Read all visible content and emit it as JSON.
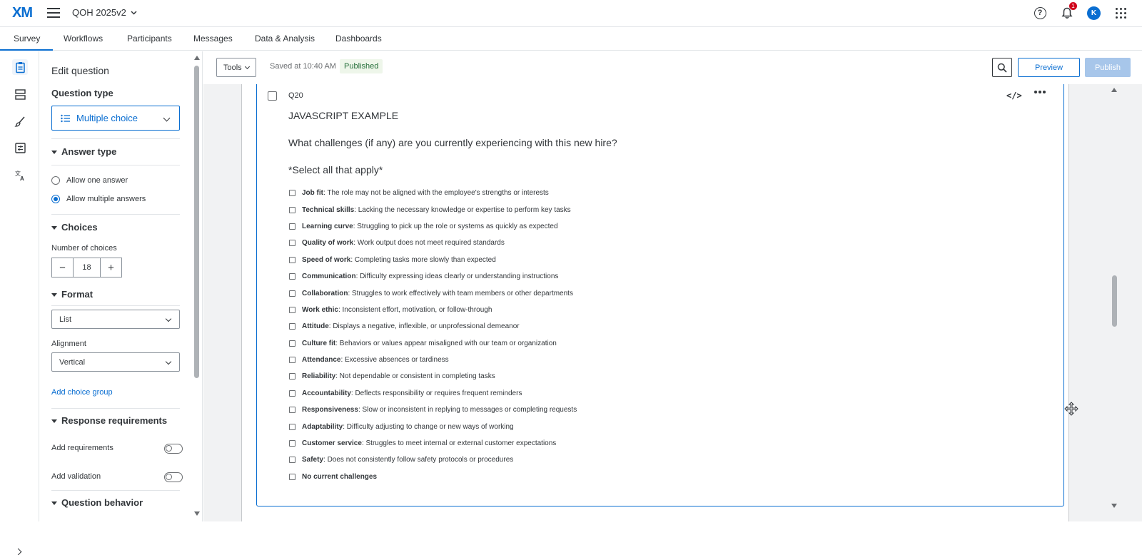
{
  "header": {
    "logo": "XM",
    "project_name": "QOH 2025v2",
    "notification_count": "1",
    "avatar_initial": "K"
  },
  "nav": {
    "tabs": [
      {
        "label": "Survey",
        "active": true
      },
      {
        "label": "Workflows"
      },
      {
        "label": "Participants"
      },
      {
        "label": "Messages"
      },
      {
        "label": "Data & Analysis"
      },
      {
        "label": "Dashboards"
      }
    ]
  },
  "panel": {
    "title": "Edit question",
    "question_type_heading": "Question type",
    "question_type_value": "Multiple choice",
    "answer_type_heading": "Answer type",
    "answer_options": [
      "Allow one answer",
      "Allow multiple answers"
    ],
    "answer_selected": 1,
    "choices_heading": "Choices",
    "number_of_choices_label": "Number of choices",
    "number_of_choices_value": "18",
    "format_heading": "Format",
    "format_value": "List",
    "alignment_label": "Alignment",
    "alignment_value": "Vertical",
    "add_choice_group": "Add choice group",
    "response_requirements_heading": "Response requirements",
    "add_requirements": "Add requirements",
    "add_validation": "Add validation",
    "question_behavior_heading": "Question behavior"
  },
  "toolbar": {
    "tools_label": "Tools",
    "saved_text": "Saved at 10:40 AM",
    "status_badge": "Published",
    "preview_label": "Preview",
    "publish_label": "Publish"
  },
  "question": {
    "number": "Q20",
    "heading": "JAVASCRIPT EXAMPLE",
    "text": "What challenges (if any) are you currently experiencing with this new hire?",
    "subtext": "*Select all that apply*",
    "choices": [
      {
        "bold": "Job fit",
        "rest": ": The role may not be aligned with the employee's strengths or interests"
      },
      {
        "bold": "Technical skills",
        "rest": ": Lacking the necessary knowledge or expertise to perform key tasks"
      },
      {
        "bold": "Learning curve",
        "rest": ": Struggling to pick up the role or systems as quickly as expected"
      },
      {
        "bold": "Quality of work",
        "rest": ": Work output does not meet required standards"
      },
      {
        "bold": "Speed of work",
        "rest": ": Completing tasks more slowly than expected"
      },
      {
        "bold": "Communication",
        "rest": ": Difficulty expressing ideas clearly or understanding instructions"
      },
      {
        "bold": "Collaboration",
        "rest": ": Struggles to work effectively with team members or other departments"
      },
      {
        "bold": "Work ethic",
        "rest": ": Inconsistent effort, motivation, or follow-through"
      },
      {
        "bold": "Attitude",
        "rest": ": Displays a negative, inflexible, or unprofessional demeanor"
      },
      {
        "bold": "Culture fit",
        "rest": ": Behaviors or values appear misaligned with our team or organization"
      },
      {
        "bold": "Attendance",
        "rest": ": Excessive absences or tardiness"
      },
      {
        "bold": "Reliability",
        "rest": ": Not dependable or consistent in completing tasks"
      },
      {
        "bold": "Accountability",
        "rest": ": Deflects responsibility or requires frequent reminders"
      },
      {
        "bold": "Responsiveness",
        "rest": ": Slow or inconsistent in replying to messages or completing requests"
      },
      {
        "bold": "Adaptability",
        "rest": ": Difficulty adjusting to change or new ways of working"
      },
      {
        "bold": "Customer service",
        "rest": ": Struggles to meet internal or external customer expectations"
      },
      {
        "bold": "Safety",
        "rest": ": Does not consistently follow safety protocols or procedures"
      },
      {
        "bold": "No current challenges",
        "rest": ""
      }
    ]
  },
  "colors": {
    "accent": "#0a6ed1",
    "published_bg": "#eef6ea",
    "published_text": "#256f3a",
    "badge": "#d0021b"
  }
}
